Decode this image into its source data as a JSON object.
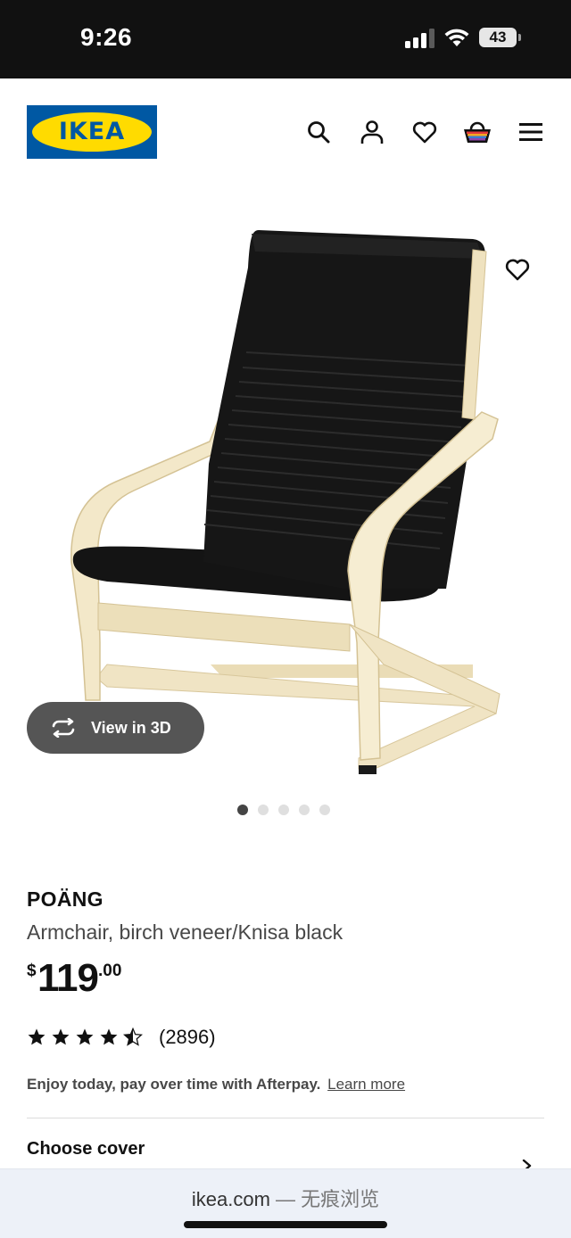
{
  "status_bar": {
    "time": "9:26",
    "battery": "43"
  },
  "header": {
    "logo_text": "IKEA",
    "icons": [
      "search-icon",
      "account-icon",
      "heart-icon",
      "shopping-bag-icon",
      "menu-icon"
    ]
  },
  "gallery": {
    "view_3d_label": "View in 3D",
    "slide_count": 5,
    "active_slide": 1
  },
  "product": {
    "name": "POÄNG",
    "description": "Armchair, birch veneer/Knisa black",
    "price_currency": "$",
    "price_integer": "119",
    "price_decimal": ".00",
    "rating_stars": 4.5,
    "rating_count": "(2896)",
    "afterpay_text": "Enjoy today, pay over time with Afterpay.",
    "afterpay_link": "Learn more",
    "choose_cover_label": "Choose cover"
  },
  "browser": {
    "url": "ikea.com",
    "mode": " — 无痕浏览"
  },
  "colors": {
    "ikea_blue": "#0058a3",
    "ikea_yellow": "#ffdb00",
    "status_bar": "#111111",
    "browser_bar": "#edf1f8"
  }
}
